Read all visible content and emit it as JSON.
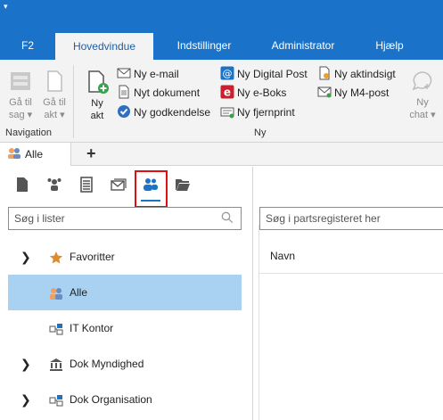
{
  "ribbon_tabs": [
    {
      "label": "F2"
    },
    {
      "label": "Hovedvindue",
      "active": true
    },
    {
      "label": "Indstillinger"
    },
    {
      "label": "Administrator"
    },
    {
      "label": "Hjælp"
    }
  ],
  "navigation": {
    "go_to_case_line1": "Gå til",
    "go_to_case_line2": "sag",
    "go_to_file_line1": "Gå til",
    "go_to_file_line2": "akt",
    "group_label": "Navigation"
  },
  "new_group": {
    "new_file_line1": "Ny",
    "new_file_line2": "akt",
    "new_email": "Ny e-mail",
    "new_document": "Nyt dokument",
    "new_approval": "Ny godkendelse",
    "new_digital_post": "Ny Digital Post",
    "new_eboks": "Ny e-Boks",
    "new_remote_print": "Ny fjernprint",
    "new_access_request": "Ny aktindsigt",
    "new_m4_post": "Ny M4-post",
    "new_chat_line1": "Ny",
    "new_chat_line2": "chat",
    "group_label": "Ny"
  },
  "doc_tabs": {
    "current_tab": "Alle",
    "add_tab": "+"
  },
  "left_panel": {
    "search_placeholder": "Søg i lister",
    "tree": [
      {
        "label": "Favoritter",
        "expandable": true,
        "icon": "star-icon"
      },
      {
        "label": "Alle",
        "expandable": false,
        "icon": "people-icon",
        "selected": true
      },
      {
        "label": "IT Kontor",
        "expandable": false,
        "icon": "org-unit-icon"
      },
      {
        "label": "Dok Myndighed",
        "expandable": true,
        "icon": "authority-icon"
      },
      {
        "label": "Dok Organisation",
        "expandable": true,
        "icon": "org-unit-icon"
      }
    ]
  },
  "right_panel": {
    "search_placeholder": "Søg i partsregisteret her",
    "column_header": "Navn"
  },
  "colors": {
    "brand_blue": "#1a73c9",
    "ribbon_bg": "#f3f3f3",
    "selected_row": "#a9d1f2",
    "highlight_red": "#d11111"
  }
}
